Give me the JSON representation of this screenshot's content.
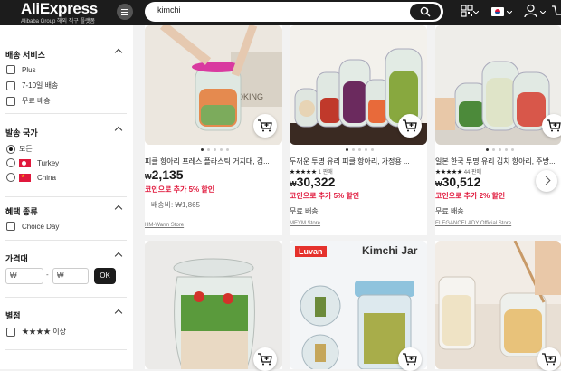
{
  "header": {
    "logo": "AliExpress",
    "logo_sub": "Alibaba Group 해외 직구 플랫폼",
    "search_value": "kimchi"
  },
  "filters": {
    "shipping": {
      "title": "배송 서비스",
      "options": [
        "Plus",
        "7-10일 배송",
        "무료 배송"
      ]
    },
    "country": {
      "title": "발송 국가",
      "options": [
        "모든",
        "Turkey",
        "China"
      ]
    },
    "benefits": {
      "title": "혜택 종류",
      "options": [
        "Choice Day"
      ]
    },
    "price": {
      "title": "가격대",
      "min_placeholder": "₩",
      "max_placeholder": "₩",
      "dash": "-",
      "ok": "OK"
    },
    "rating": {
      "title": "별점",
      "option": "★★★★ 이상"
    }
  },
  "products": [
    {
      "title": "피클 항아리 프레스 플라스틱 거치대, 김...",
      "currency": "₩",
      "price": "2,135",
      "coupon": "코인으로 추가 5% 할인",
      "shipping": "+ 배송비: ₩1,865",
      "store": "HM-Warm Store"
    },
    {
      "title": "두꺼운 투명 유리 피클 항아리, 가정용 ...",
      "rating_stars": "★★★★★",
      "rating_text": "1 판매",
      "currency": "₩",
      "price": "30,322",
      "coupon": "코인으로 추가 5% 할인",
      "shipping": "무료 배송",
      "store": "MEYM Store"
    },
    {
      "title": "일본 한국 투명 유리 김치 항아리, 주방...",
      "rating_stars": "★★★★★",
      "rating_text": "44 판매",
      "currency": "₩",
      "price": "30,512",
      "coupon": "코인으로 추가 2% 할인",
      "shipping": "무료 배송",
      "store": "ELEGANCELADY Official Store"
    }
  ],
  "second_row": {
    "brand_badge": "Luvan",
    "jar_text": "Kimchi Jar"
  },
  "icons": [
    "menu-icon",
    "search-icon",
    "qr-icon",
    "flag-kr-icon",
    "user-icon",
    "cart-icon",
    "chevron-right-icon"
  ]
}
